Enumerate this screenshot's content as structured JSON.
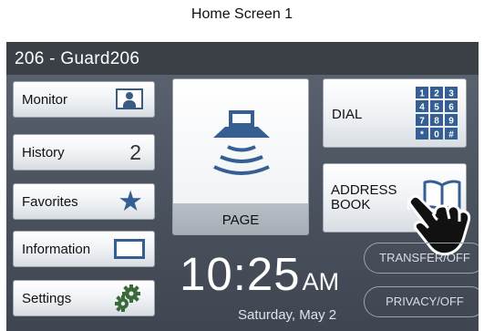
{
  "caption": "Home Screen 1",
  "title_bar": {
    "station": "206 - Guard206"
  },
  "side_menu": {
    "monitor": {
      "label": "Monitor",
      "icon": "monitor-icon"
    },
    "history": {
      "label": "History",
      "count": "2"
    },
    "favorites": {
      "label": "Favorites",
      "icon": "star-icon"
    },
    "information": {
      "label": "Information",
      "icon": "information-icon"
    },
    "settings": {
      "label": "Settings",
      "icon": "gear-icon"
    }
  },
  "page_button": {
    "label": "PAGE",
    "icon": "paging-speaker-icon"
  },
  "dial_button": {
    "label": "DIAL",
    "keypad": [
      "1",
      "2",
      "3",
      "4",
      "5",
      "6",
      "7",
      "8",
      "9",
      "*",
      "0",
      "#"
    ]
  },
  "address_book_button": {
    "label_line1": "ADDRESS",
    "label_line2": "BOOK",
    "icon": "book-icon"
  },
  "clock": {
    "time": "10:25",
    "ampm": "AM",
    "date": "Saturday, May 2"
  },
  "status": {
    "transfer": "TRANSFER/OFF",
    "privacy": "PRIVACY/OFF"
  },
  "colors": {
    "accent": "#355f92",
    "title_bar": "#3b3f46",
    "screen_bg": "#4a525e"
  }
}
